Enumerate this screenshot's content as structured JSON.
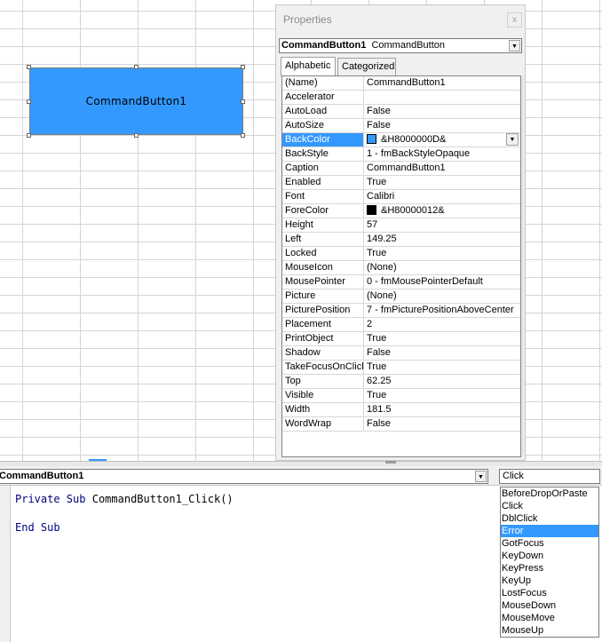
{
  "sheet": {
    "button_caption": "CommandButton1"
  },
  "properties": {
    "title": "Properties",
    "close_glyph": "x",
    "object_name": "CommandButton1",
    "object_type": "CommandButton",
    "tabs": [
      "Alphabetic",
      "Categorized"
    ],
    "rows": [
      {
        "name": "(Name)",
        "value": "CommandButton1"
      },
      {
        "name": "Accelerator",
        "value": ""
      },
      {
        "name": "AutoLoad",
        "value": "False"
      },
      {
        "name": "AutoSize",
        "value": "False"
      },
      {
        "name": "BackColor",
        "value": "&H8000000D&",
        "swatch": "#3399ff",
        "selected": true
      },
      {
        "name": "BackStyle",
        "value": "1 - fmBackStyleOpaque"
      },
      {
        "name": "Caption",
        "value": "CommandButton1"
      },
      {
        "name": "Enabled",
        "value": "True"
      },
      {
        "name": "Font",
        "value": "Calibri"
      },
      {
        "name": "ForeColor",
        "value": "&H80000012&",
        "swatch": "#000000"
      },
      {
        "name": "Height",
        "value": "57"
      },
      {
        "name": "Left",
        "value": "149.25"
      },
      {
        "name": "Locked",
        "value": "True"
      },
      {
        "name": "MouseIcon",
        "value": "(None)"
      },
      {
        "name": "MousePointer",
        "value": "0 - fmMousePointerDefault"
      },
      {
        "name": "Picture",
        "value": "(None)"
      },
      {
        "name": "PicturePosition",
        "value": "7 - fmPicturePositionAboveCenter"
      },
      {
        "name": "Placement",
        "value": "2"
      },
      {
        "name": "PrintObject",
        "value": "True"
      },
      {
        "name": "Shadow",
        "value": "False"
      },
      {
        "name": "TakeFocusOnClick",
        "value": "True"
      },
      {
        "name": "Top",
        "value": "62.25"
      },
      {
        "name": "Visible",
        "value": "True"
      },
      {
        "name": "Width",
        "value": "181.5"
      },
      {
        "name": "WordWrap",
        "value": "False"
      }
    ]
  },
  "code": {
    "object_combo": "CommandButton1",
    "procedure_combo": "Click",
    "lines": [
      {
        "keyword": "Private Sub",
        "text": "CommandButton1_Click()"
      },
      {
        "keyword": "End Sub",
        "text": ""
      }
    ],
    "procedure_list": [
      "BeforeDropOrPaste",
      "Click",
      "DblClick",
      "Error",
      "GotFocus",
      "KeyDown",
      "KeyPress",
      "KeyUp",
      "LostFocus",
      "MouseDown",
      "MouseMove",
      "MouseUp"
    ],
    "selected_procedure": "Error"
  },
  "colors": {
    "accent": "#3399ff",
    "code_keyword": "#00007f"
  },
  "icons": {
    "dropdown": "chevron-down-icon",
    "close": "close-icon"
  }
}
